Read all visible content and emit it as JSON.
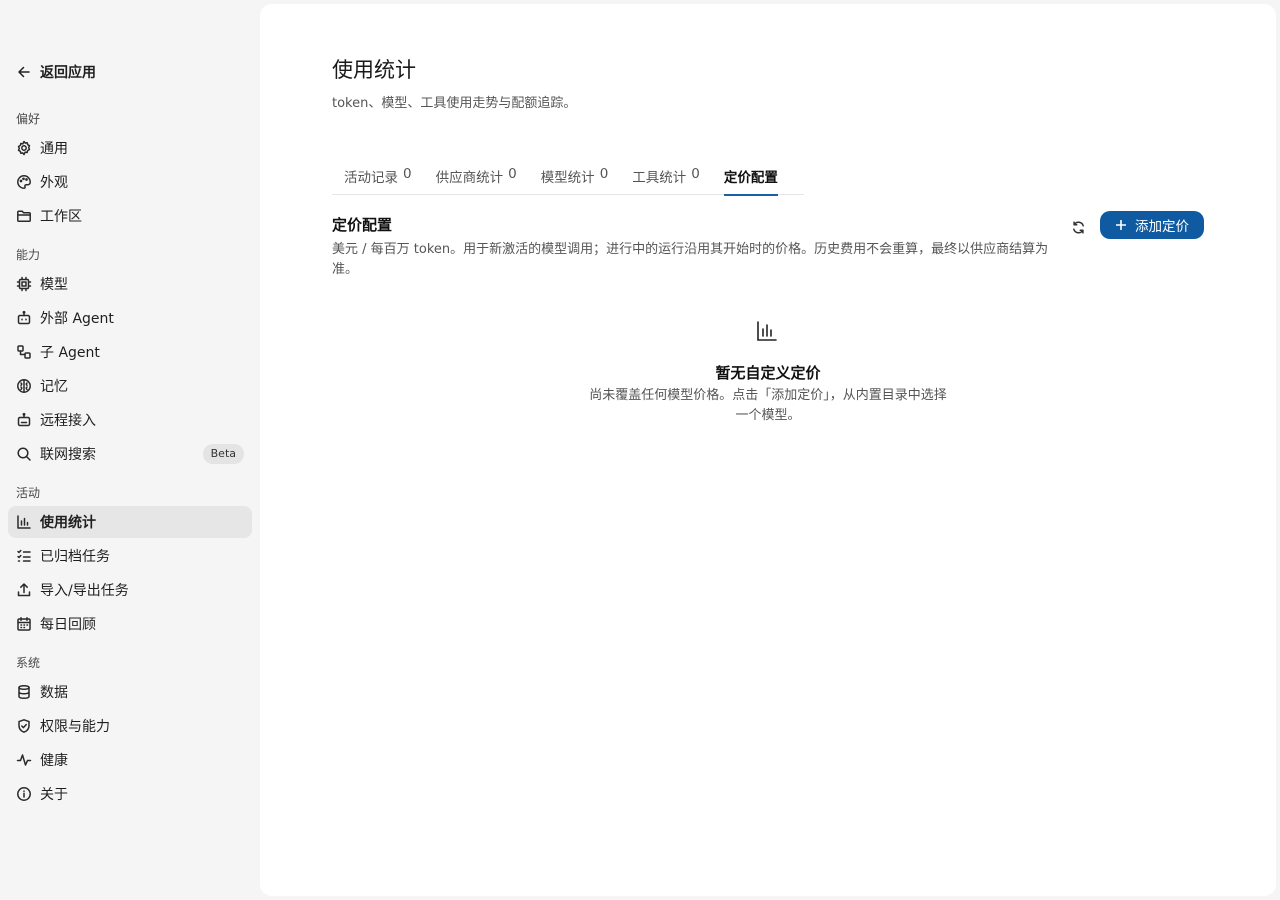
{
  "sidebar": {
    "back_label": "返回应用",
    "groups": [
      {
        "label": "偏好"
      },
      {
        "label": "能力"
      },
      {
        "label": "活动"
      },
      {
        "label": "系统"
      }
    ],
    "items": [
      {
        "label": "通用",
        "icon": "gear-icon"
      },
      {
        "label": "外观",
        "icon": "palette-icon"
      },
      {
        "label": "工作区",
        "icon": "folder-icon"
      },
      {
        "label": "模型",
        "icon": "chip-icon"
      },
      {
        "label": "外部 Agent",
        "icon": "robot-icon"
      },
      {
        "label": "子 Agent",
        "icon": "subagent-icon"
      },
      {
        "label": "记忆",
        "icon": "brain-icon"
      },
      {
        "label": "远程接入",
        "icon": "remote-icon"
      },
      {
        "label": "联网搜索",
        "icon": "search-icon",
        "badge": "Beta"
      },
      {
        "label": "使用统计",
        "icon": "bar-chart-icon",
        "active": true
      },
      {
        "label": "已归档任务",
        "icon": "checklist-icon"
      },
      {
        "label": "导入/导出任务",
        "icon": "upload-icon"
      },
      {
        "label": "每日回顾",
        "icon": "calendar-icon"
      },
      {
        "label": "数据",
        "icon": "database-icon"
      },
      {
        "label": "权限与能力",
        "icon": "shield-icon"
      },
      {
        "label": "健康",
        "icon": "pulse-icon"
      },
      {
        "label": "关于",
        "icon": "info-icon"
      }
    ]
  },
  "main": {
    "title": "使用统计",
    "subtitle": "token、模型、工具使用走势与配额追踪。",
    "tabs": [
      {
        "label": "活动记录",
        "count": "0"
      },
      {
        "label": "供应商统计",
        "count": "0"
      },
      {
        "label": "模型统计",
        "count": "0"
      },
      {
        "label": "工具统计",
        "count": "0"
      },
      {
        "label": "定价配置",
        "count": "",
        "active": true
      }
    ],
    "section": {
      "title": "定价配置",
      "description": "美元 / 每百万 token。用于新激活的模型调用；进行中的运行沿用其开始时的价格。历史费用不会重算，最终以供应商结算为准。",
      "add_label": "添加定价"
    },
    "empty": {
      "title": "暂无自定义定价",
      "description": "尚未覆盖任何模型价格。点击「添加定价」，从内置目录中选择一个模型。"
    }
  },
  "colors": {
    "accent": "#0f5aa0",
    "active_nav_bg": "#e6e6e6",
    "sidebar_bg": "#f5f5f5"
  }
}
